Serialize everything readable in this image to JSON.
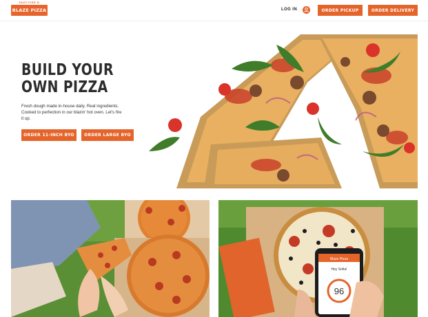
{
  "header": {
    "logo_tagline": "FAST-FIRE'D",
    "logo_text": "BLAZE PIZZA",
    "login_label": "LOG IN",
    "order_pickup_label": "ORDER PICKUP",
    "order_delivery_label": "ORDER DELIVERY"
  },
  "hero": {
    "title_line1": "BUILD YOUR",
    "title_line2": "OWN PIZZA",
    "description": "Fresh dough made in-house daily. Real ingredients. Cooked to perfection in our blazin' hot oven. Let's fire it up.",
    "button_11_inch": "ORDER 11-INCH BYO",
    "button_large": "ORDER LARGE BYO"
  },
  "phone": {
    "app_text": "Blaze Pizza",
    "greeting": "Hey Sofia!",
    "points": "96"
  },
  "colors": {
    "brand_orange": "#e5642a",
    "text_dark": "#2b2b2b"
  }
}
